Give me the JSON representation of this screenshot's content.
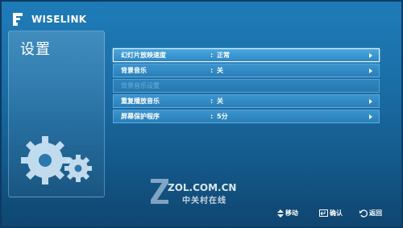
{
  "brand": {
    "name": "WISELINK"
  },
  "page": {
    "title": "设置"
  },
  "menu": {
    "items": [
      {
        "label": "幻灯片放映速度",
        "colon": ":",
        "value": "正常",
        "state": "selected"
      },
      {
        "label": "背景音乐",
        "colon": ":",
        "value": "关",
        "state": "normal"
      },
      {
        "label": "背景音乐设置",
        "colon": "",
        "value": "",
        "state": "disabled"
      },
      {
        "label": "重复播放音乐",
        "colon": ":",
        "value": "关",
        "state": "normal"
      },
      {
        "label": "屏幕保护程序",
        "colon": ":",
        "value": "5分",
        "state": "normal"
      }
    ]
  },
  "watermark": {
    "text": "ZOL.COM.CN",
    "subtext": "中关村在线"
  },
  "hints": {
    "move": "移动",
    "ok": "确认",
    "back": "返回"
  },
  "icons": [
    "wiselink-logo-icon",
    "gears-icon",
    "updown-arrows-icon",
    "enter-icon",
    "return-icon",
    "chevron-right-icon"
  ]
}
